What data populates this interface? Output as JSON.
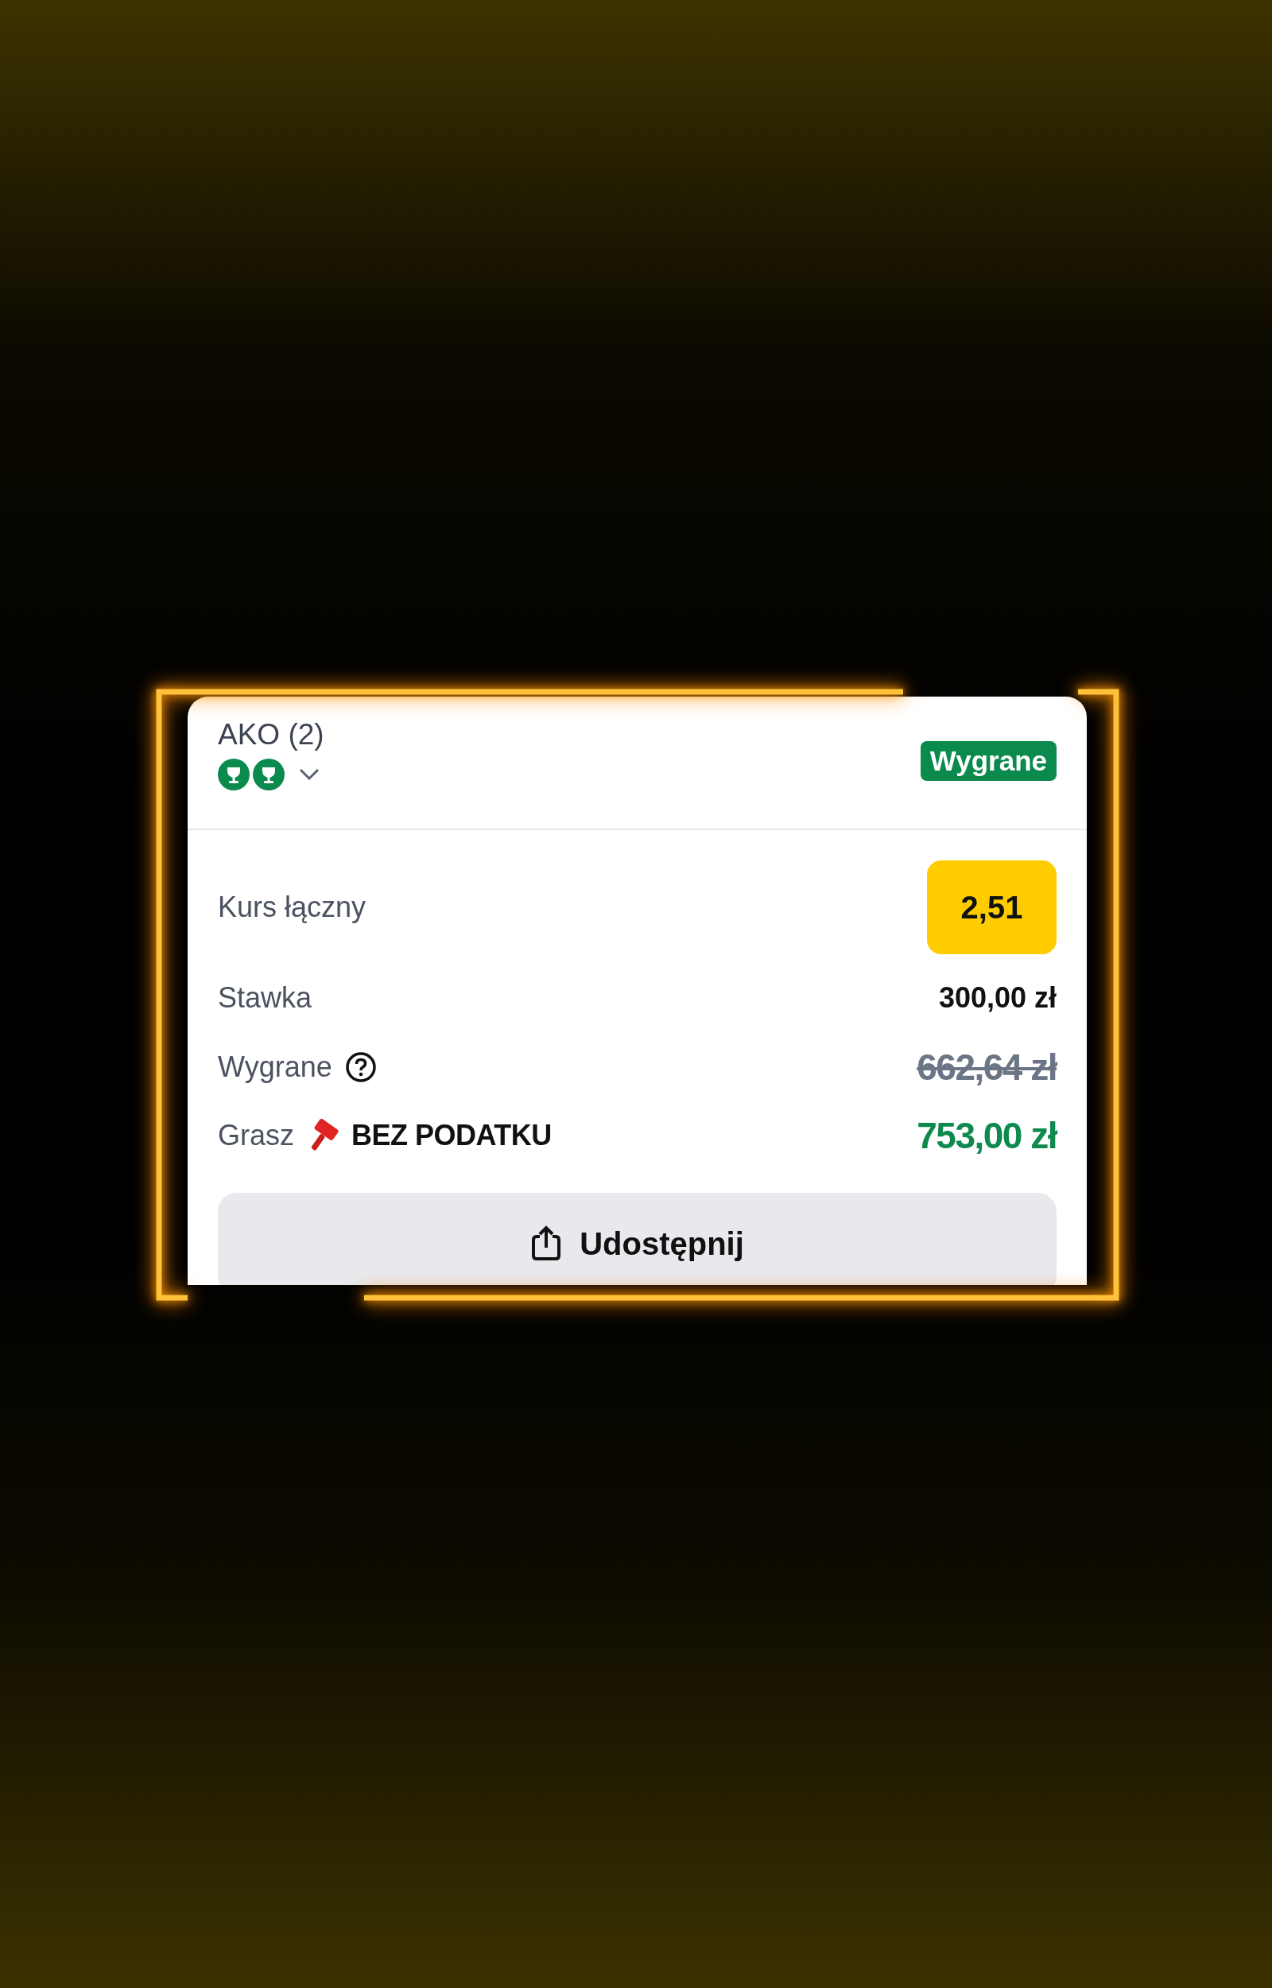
{
  "bet": {
    "title": "AKO (2)",
    "legs": [
      {
        "won": true
      },
      {
        "won": true
      }
    ],
    "expanded": false,
    "status": "Wygrane"
  },
  "rows": [
    {
      "kind": "odds",
      "label": "Kurs łączny",
      "value": "2,51"
    },
    {
      "kind": "plain",
      "label": "Stawka",
      "value": "300,00 zł"
    },
    {
      "kind": "struck",
      "label": "Wygrane",
      "help": true,
      "value": "662,64 zł"
    },
    {
      "kind": "bonus",
      "label": "Grasz",
      "badge": "BEZ PODATKU",
      "value": "753,00 zł"
    }
  ],
  "share_button": "Udostępnij"
}
